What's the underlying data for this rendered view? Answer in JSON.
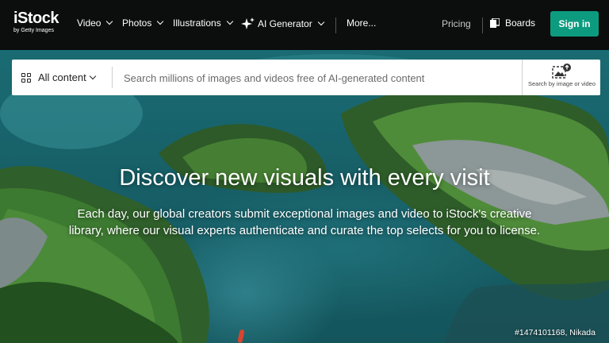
{
  "header": {
    "logo": {
      "main": "iStock",
      "sub": "by Getty Images"
    },
    "nav": [
      {
        "label": "Video"
      },
      {
        "label": "Photos"
      },
      {
        "label": "Illustrations"
      },
      {
        "label": "AI Generator"
      },
      {
        "label": "More..."
      }
    ],
    "pricing": "Pricing",
    "boards": "Boards",
    "signin": "Sign in"
  },
  "search": {
    "category": "All content",
    "placeholder": "Search millions of images and videos free of AI-generated content",
    "value": "",
    "image_search_label": "Search by image or video"
  },
  "hero": {
    "headline": "Discover new visuals with every visit",
    "subtext": "Each day, our global creators submit exceptional images and video to iStock's creative library, where our visual experts authenticate and curate the top selects for you to license.",
    "credit": "#1474101168, Nikada"
  },
  "colors": {
    "signin_bg": "#0d9b80",
    "topbar_bg": "#0c0d0d",
    "water": "#1a6b73",
    "forest": "#3f7a2c"
  }
}
